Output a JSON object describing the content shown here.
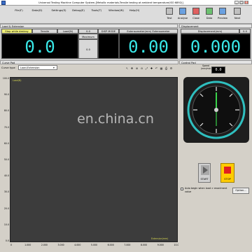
{
  "window": {
    "title": "Universal Testing Machine Computer System-[Metallic materials-Tensile testing at ambient temperature(ISO 6892)]",
    "min": "_",
    "max": "□",
    "close": "X"
  },
  "menu": [
    "File(F)",
    "Data(D)",
    "Settings(S)",
    "Debug(E)",
    "Tools(T)",
    "Window(W)",
    "Help(H)"
  ],
  "toolbar": [
    "Test",
    "Analyse",
    "Close",
    "Data",
    "Preview",
    "Next"
  ],
  "load_panel": {
    "header": "Load & Extension",
    "stop_label": "Stop while destroy",
    "mode_label": "Tensile",
    "load_label": "Load(N)",
    "load_zero": "0.0",
    "maximum_label": "Maximum",
    "maximum_value": "0.0",
    "disp_mode": "DISP MODE",
    "ext_label": "Extensometer(mm)",
    "ext_label2": "Extensometer",
    "load_value": "0.0",
    "ext_value": "0.00"
  },
  "disp_panel": {
    "header": "Displacement",
    "label": "Displacement(mm)",
    "zero": "0.0",
    "value": "0.000"
  },
  "curve_pad": {
    "header": "Curve Pad",
    "type_label": "Curve type",
    "type_value": "Load-Extension",
    "y_label": "Load(N)",
    "x_label": "Extension(mm)",
    "y_ticks": [
      "100.0",
      "90.0",
      "80.0",
      "70.0",
      "60.0",
      "50.0",
      "40.0",
      "30.0",
      "20.0",
      "10.0",
      "0.0"
    ],
    "x_ticks": [
      "0",
      "1.000",
      "2.000",
      "3.000",
      "4.000",
      "5.000",
      "6.000",
      "7.000",
      "8.000",
      "9.000",
      "10.00"
    ]
  },
  "control_pad": {
    "header": "Control Pad",
    "speed_label": "Speed (mm/min)",
    "speed_value": "0.0",
    "start": "START",
    "stop": "STOP",
    "auto_begin": "Auto begin when load > enactment value",
    "option": "Option..."
  },
  "watermark": "en.china.cn",
  "colors": {
    "lcd_text": "#39e8e8",
    "plot_bg": "#3c3c3c",
    "dial_ring": "#2fbfbf",
    "stop_btn": "#ffcc00",
    "stop_square": "#e02020"
  }
}
